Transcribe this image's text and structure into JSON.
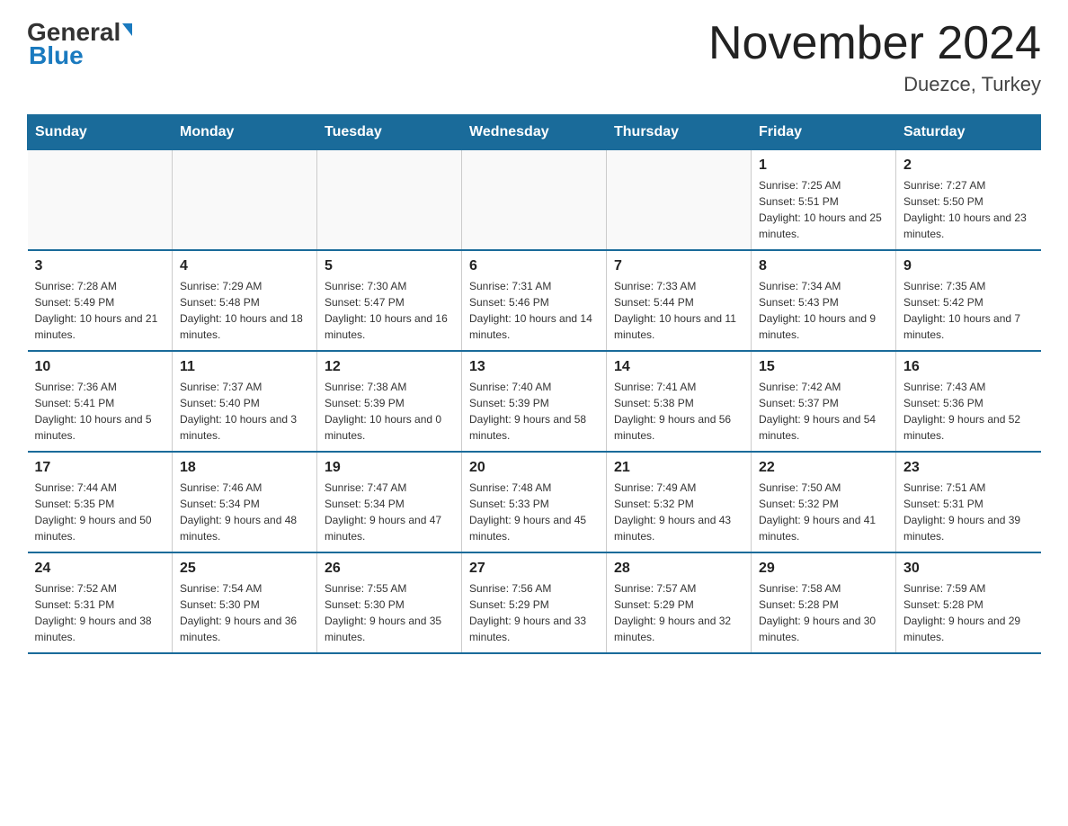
{
  "header": {
    "logo_general": "General",
    "logo_blue": "Blue",
    "title": "November 2024",
    "subtitle": "Duezce, Turkey"
  },
  "days_of_week": [
    "Sunday",
    "Monday",
    "Tuesday",
    "Wednesday",
    "Thursday",
    "Friday",
    "Saturday"
  ],
  "weeks": [
    [
      {
        "day": "",
        "sunrise": "",
        "sunset": "",
        "daylight": ""
      },
      {
        "day": "",
        "sunrise": "",
        "sunset": "",
        "daylight": ""
      },
      {
        "day": "",
        "sunrise": "",
        "sunset": "",
        "daylight": ""
      },
      {
        "day": "",
        "sunrise": "",
        "sunset": "",
        "daylight": ""
      },
      {
        "day": "",
        "sunrise": "",
        "sunset": "",
        "daylight": ""
      },
      {
        "day": "1",
        "sunrise": "Sunrise: 7:25 AM",
        "sunset": "Sunset: 5:51 PM",
        "daylight": "Daylight: 10 hours and 25 minutes."
      },
      {
        "day": "2",
        "sunrise": "Sunrise: 7:27 AM",
        "sunset": "Sunset: 5:50 PM",
        "daylight": "Daylight: 10 hours and 23 minutes."
      }
    ],
    [
      {
        "day": "3",
        "sunrise": "Sunrise: 7:28 AM",
        "sunset": "Sunset: 5:49 PM",
        "daylight": "Daylight: 10 hours and 21 minutes."
      },
      {
        "day": "4",
        "sunrise": "Sunrise: 7:29 AM",
        "sunset": "Sunset: 5:48 PM",
        "daylight": "Daylight: 10 hours and 18 minutes."
      },
      {
        "day": "5",
        "sunrise": "Sunrise: 7:30 AM",
        "sunset": "Sunset: 5:47 PM",
        "daylight": "Daylight: 10 hours and 16 minutes."
      },
      {
        "day": "6",
        "sunrise": "Sunrise: 7:31 AM",
        "sunset": "Sunset: 5:46 PM",
        "daylight": "Daylight: 10 hours and 14 minutes."
      },
      {
        "day": "7",
        "sunrise": "Sunrise: 7:33 AM",
        "sunset": "Sunset: 5:44 PM",
        "daylight": "Daylight: 10 hours and 11 minutes."
      },
      {
        "day": "8",
        "sunrise": "Sunrise: 7:34 AM",
        "sunset": "Sunset: 5:43 PM",
        "daylight": "Daylight: 10 hours and 9 minutes."
      },
      {
        "day": "9",
        "sunrise": "Sunrise: 7:35 AM",
        "sunset": "Sunset: 5:42 PM",
        "daylight": "Daylight: 10 hours and 7 minutes."
      }
    ],
    [
      {
        "day": "10",
        "sunrise": "Sunrise: 7:36 AM",
        "sunset": "Sunset: 5:41 PM",
        "daylight": "Daylight: 10 hours and 5 minutes."
      },
      {
        "day": "11",
        "sunrise": "Sunrise: 7:37 AM",
        "sunset": "Sunset: 5:40 PM",
        "daylight": "Daylight: 10 hours and 3 minutes."
      },
      {
        "day": "12",
        "sunrise": "Sunrise: 7:38 AM",
        "sunset": "Sunset: 5:39 PM",
        "daylight": "Daylight: 10 hours and 0 minutes."
      },
      {
        "day": "13",
        "sunrise": "Sunrise: 7:40 AM",
        "sunset": "Sunset: 5:39 PM",
        "daylight": "Daylight: 9 hours and 58 minutes."
      },
      {
        "day": "14",
        "sunrise": "Sunrise: 7:41 AM",
        "sunset": "Sunset: 5:38 PM",
        "daylight": "Daylight: 9 hours and 56 minutes."
      },
      {
        "day": "15",
        "sunrise": "Sunrise: 7:42 AM",
        "sunset": "Sunset: 5:37 PM",
        "daylight": "Daylight: 9 hours and 54 minutes."
      },
      {
        "day": "16",
        "sunrise": "Sunrise: 7:43 AM",
        "sunset": "Sunset: 5:36 PM",
        "daylight": "Daylight: 9 hours and 52 minutes."
      }
    ],
    [
      {
        "day": "17",
        "sunrise": "Sunrise: 7:44 AM",
        "sunset": "Sunset: 5:35 PM",
        "daylight": "Daylight: 9 hours and 50 minutes."
      },
      {
        "day": "18",
        "sunrise": "Sunrise: 7:46 AM",
        "sunset": "Sunset: 5:34 PM",
        "daylight": "Daylight: 9 hours and 48 minutes."
      },
      {
        "day": "19",
        "sunrise": "Sunrise: 7:47 AM",
        "sunset": "Sunset: 5:34 PM",
        "daylight": "Daylight: 9 hours and 47 minutes."
      },
      {
        "day": "20",
        "sunrise": "Sunrise: 7:48 AM",
        "sunset": "Sunset: 5:33 PM",
        "daylight": "Daylight: 9 hours and 45 minutes."
      },
      {
        "day": "21",
        "sunrise": "Sunrise: 7:49 AM",
        "sunset": "Sunset: 5:32 PM",
        "daylight": "Daylight: 9 hours and 43 minutes."
      },
      {
        "day": "22",
        "sunrise": "Sunrise: 7:50 AM",
        "sunset": "Sunset: 5:32 PM",
        "daylight": "Daylight: 9 hours and 41 minutes."
      },
      {
        "day": "23",
        "sunrise": "Sunrise: 7:51 AM",
        "sunset": "Sunset: 5:31 PM",
        "daylight": "Daylight: 9 hours and 39 minutes."
      }
    ],
    [
      {
        "day": "24",
        "sunrise": "Sunrise: 7:52 AM",
        "sunset": "Sunset: 5:31 PM",
        "daylight": "Daylight: 9 hours and 38 minutes."
      },
      {
        "day": "25",
        "sunrise": "Sunrise: 7:54 AM",
        "sunset": "Sunset: 5:30 PM",
        "daylight": "Daylight: 9 hours and 36 minutes."
      },
      {
        "day": "26",
        "sunrise": "Sunrise: 7:55 AM",
        "sunset": "Sunset: 5:30 PM",
        "daylight": "Daylight: 9 hours and 35 minutes."
      },
      {
        "day": "27",
        "sunrise": "Sunrise: 7:56 AM",
        "sunset": "Sunset: 5:29 PM",
        "daylight": "Daylight: 9 hours and 33 minutes."
      },
      {
        "day": "28",
        "sunrise": "Sunrise: 7:57 AM",
        "sunset": "Sunset: 5:29 PM",
        "daylight": "Daylight: 9 hours and 32 minutes."
      },
      {
        "day": "29",
        "sunrise": "Sunrise: 7:58 AM",
        "sunset": "Sunset: 5:28 PM",
        "daylight": "Daylight: 9 hours and 30 minutes."
      },
      {
        "day": "30",
        "sunrise": "Sunrise: 7:59 AM",
        "sunset": "Sunset: 5:28 PM",
        "daylight": "Daylight: 9 hours and 29 minutes."
      }
    ]
  ]
}
